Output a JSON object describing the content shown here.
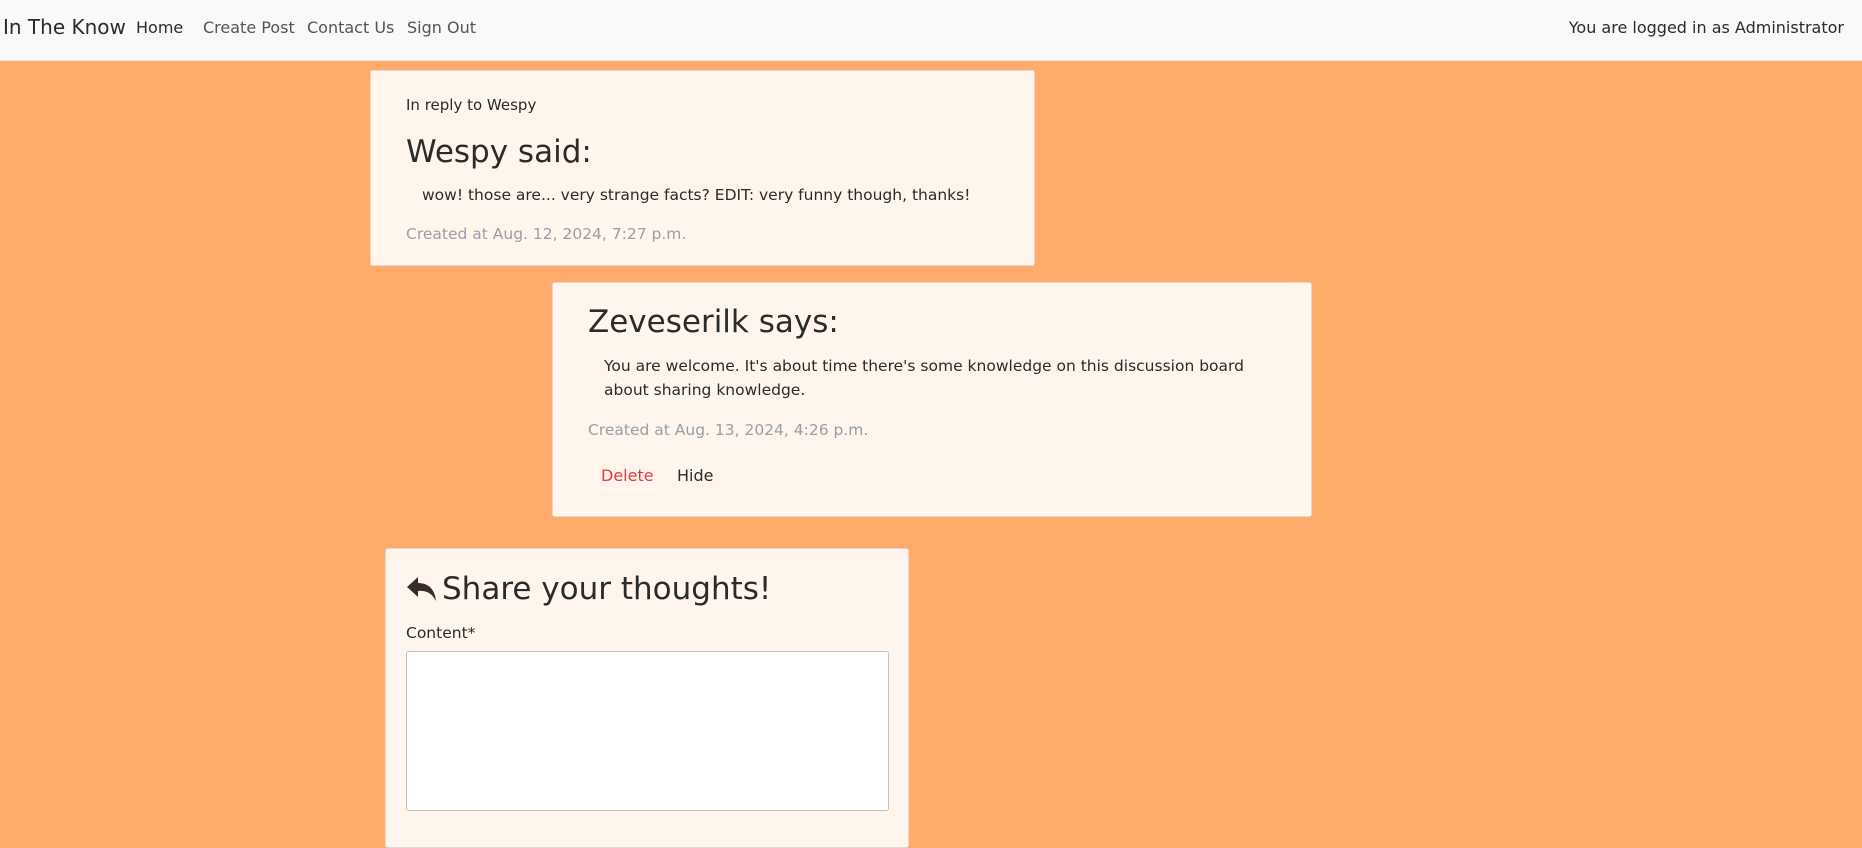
{
  "navbar": {
    "brand": "In The Know",
    "links": [
      {
        "label": "Home"
      },
      {
        "label": "Create Post"
      },
      {
        "label": "Contact Us"
      },
      {
        "label": "Sign Out"
      }
    ],
    "login_status": "You are logged in as Administrator"
  },
  "parent_comment": {
    "reply_to": "In reply to Wespy",
    "author_line": "Wespy said:",
    "body": "wow! those are... very strange facts? EDIT: very funny though, thanks!",
    "created": "Created at Aug. 12, 2024, 7:27 p.m."
  },
  "reply_comment": {
    "author_line": "Zeveserilk says:",
    "body": "You are welcome. It's about time there's some knowledge on this discussion board about sharing knowledge.",
    "created": "Created at Aug. 13, 2024, 4:26 p.m.",
    "actions": {
      "delete": "Delete",
      "hide": "Hide"
    }
  },
  "reply_form": {
    "icon": "reply-icon",
    "title": "Share your thoughts!",
    "content_label": "Content*",
    "content_value": ""
  },
  "colors": {
    "page_background": "#ffab6b",
    "card_background": "#fff5ec",
    "navbar_background": "#f8f9fa",
    "delete_action": "#e23b3b",
    "meta_text": "#9a9ea8"
  }
}
